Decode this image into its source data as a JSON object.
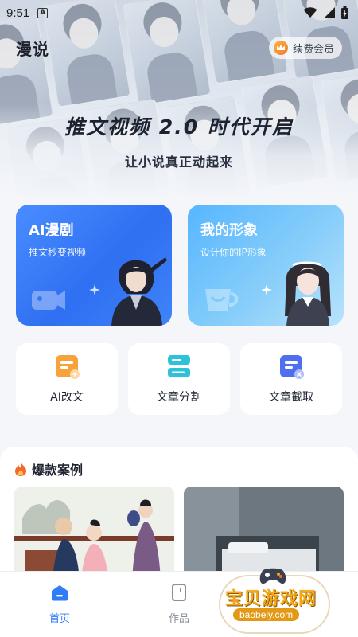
{
  "status_bar": {
    "time": "9:51",
    "a_badge": "A"
  },
  "header": {
    "app_title": "漫说",
    "vip_label": "续费会员"
  },
  "hero": {
    "slogan": "推文视频 2.0 时代开启",
    "subslogan": "让小说真正动起来"
  },
  "feature_cards": [
    {
      "title": "AI漫剧",
      "subtitle": "推文秒变视频"
    },
    {
      "title": "我的形象",
      "subtitle": "设计你的IP形象"
    }
  ],
  "tools": [
    {
      "label": "AI改文",
      "icon": "ai-rewrite-icon",
      "color": "#f7a23b"
    },
    {
      "label": "文章分割",
      "icon": "article-split-icon",
      "color": "#2fc1d8"
    },
    {
      "label": "文章截取",
      "icon": "article-extract-icon",
      "color": "#4f6ef0"
    }
  ],
  "cases": {
    "title": "爆款案例"
  },
  "bottom_nav": {
    "items": [
      {
        "label": "首页",
        "active": true
      },
      {
        "label": "作品",
        "active": false
      }
    ]
  },
  "watermark": {
    "text": "宝贝游戏网",
    "url": "baobeiy.com"
  },
  "colors": {
    "accent": "#2f7cf6",
    "drama_card": "#3a7cf7",
    "avatar_card": "#7cc6f9",
    "fire": "#f26a2a"
  }
}
